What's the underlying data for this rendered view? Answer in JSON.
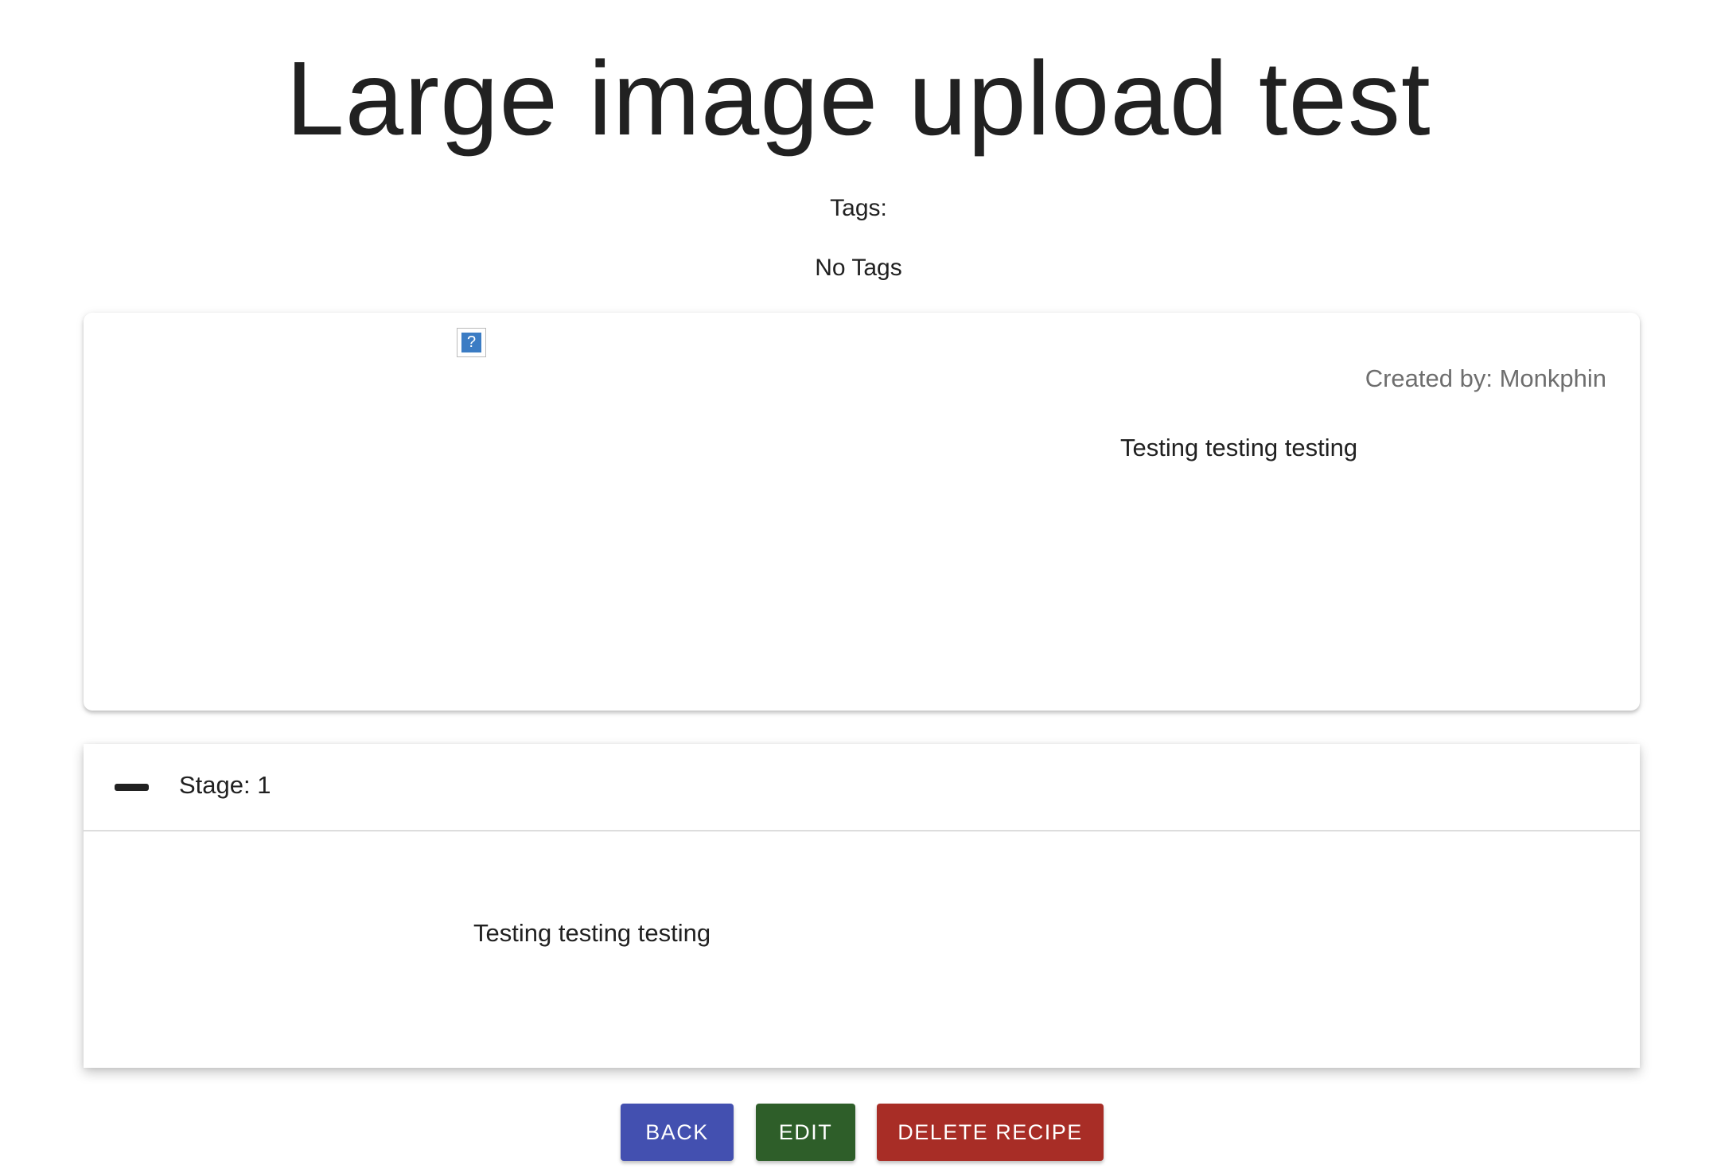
{
  "header": {
    "title": "Large image upload test",
    "tags_label": "Tags:",
    "tags_empty": "No Tags"
  },
  "recipe_card": {
    "image_icon": "broken-image-icon",
    "created_by": "Created by: Monkphin",
    "description": "Testing testing testing"
  },
  "stages": [
    {
      "title": "Stage: 1",
      "toggle_icon": "minus-icon",
      "description": "Testing testing testing"
    }
  ],
  "actions": {
    "back": "BACK",
    "edit": "EDIT",
    "delete": "DELETE RECIPE"
  },
  "colors": {
    "back": "#4350b0",
    "edit": "#2e5e29",
    "delete": "#a82d26"
  }
}
